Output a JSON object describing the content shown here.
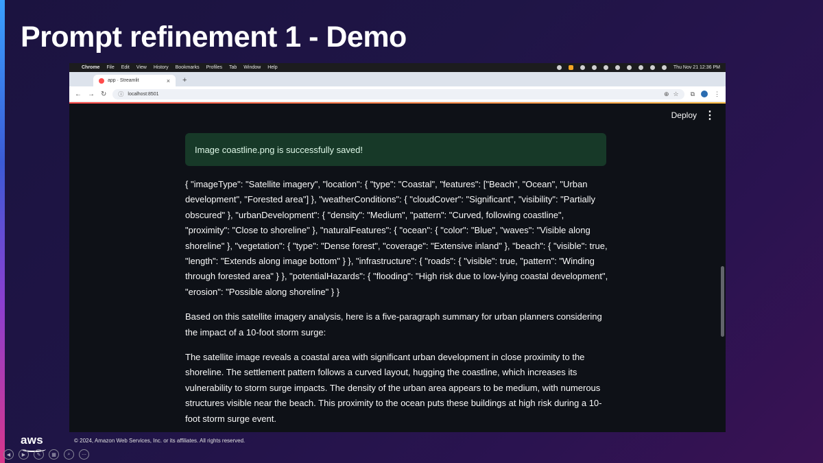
{
  "slide": {
    "title": "Prompt refinement 1 - Demo",
    "copyright": "© 2024, Amazon Web Services, Inc. or its affiliates. All rights reserved.",
    "aws_logo": "aws"
  },
  "menubar": {
    "app": "Chrome",
    "items": [
      "File",
      "Edit",
      "View",
      "History",
      "Bookmarks",
      "Profiles",
      "Tab",
      "Window",
      "Help"
    ],
    "datetime": "Thu Nov 21  12:36 PM"
  },
  "browser": {
    "tab_title": "app · Streamlit",
    "url": "localhost:8501"
  },
  "app": {
    "deploy_label": "Deploy",
    "success_message": "Image coastline.png is successfully saved!",
    "paragraphs": [
      "{ \"imageType\": \"Satellite imagery\", \"location\": { \"type\": \"Coastal\", \"features\": [\"Beach\", \"Ocean\", \"Urban development\", \"Forested area\"] }, \"weatherConditions\": { \"cloudCover\": \"Significant\", \"visibility\": \"Partially obscured\" }, \"urbanDevelopment\": { \"density\": \"Medium\", \"pattern\": \"Curved, following coastline\", \"proximity\": \"Close to shoreline\" }, \"naturalFeatures\": { \"ocean\": { \"color\": \"Blue\", \"waves\": \"Visible along shoreline\" }, \"vegetation\": { \"type\": \"Dense forest\", \"coverage\": \"Extensive inland\" }, \"beach\": { \"visible\": true, \"length\": \"Extends along image bottom\" } }, \"infrastructure\": { \"roads\": { \"visible\": true, \"pattern\": \"Winding through forested area\" } }, \"potentialHazards\": { \"flooding\": \"High risk due to low-lying coastal development\", \"erosion\": \"Possible along shoreline\" } }",
      "Based on this satellite imagery analysis, here is a five-paragraph summary for urban planners considering the impact of a 10-foot storm surge:",
      "The satellite image reveals a coastal area with significant urban development in close proximity to the shoreline. The settlement pattern follows a curved layout, hugging the coastline, which increases its vulnerability to storm surge impacts. The density of the urban area appears to be medium, with numerous structures visible near the beach. This proximity to the ocean puts these buildings at high risk during a 10-foot storm surge event."
    ]
  }
}
